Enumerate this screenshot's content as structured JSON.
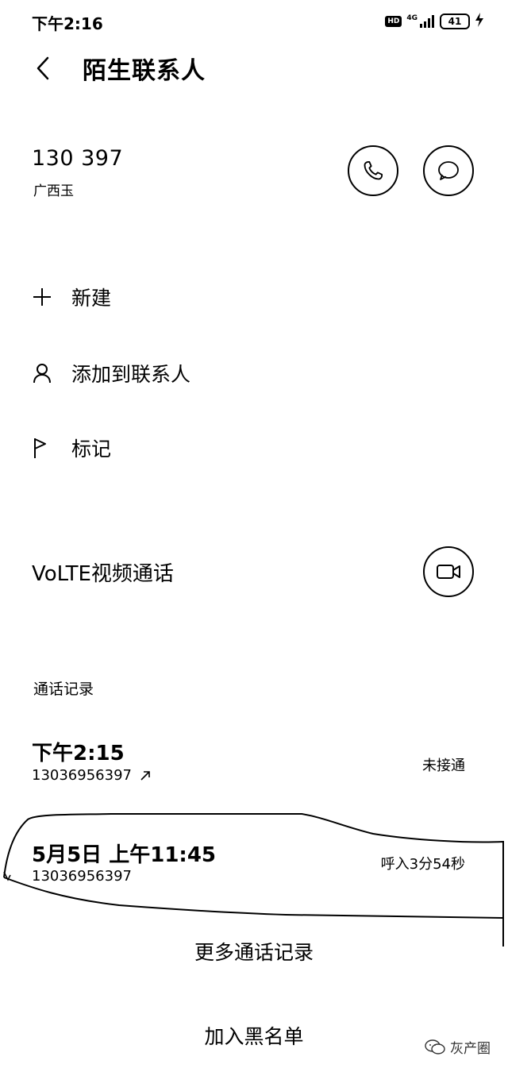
{
  "status_bar": {
    "time": "下午2:16",
    "hd_label": "HD",
    "network_label": "4G",
    "battery_level": "41"
  },
  "header": {
    "title": "陌生联系人"
  },
  "contact": {
    "phone_number": "130          397",
    "location": "广西玉"
  },
  "actions": [
    {
      "label": "新建",
      "icon": "plus-icon"
    },
    {
      "label": "添加到联系人",
      "icon": "person-icon"
    },
    {
      "label": "标记",
      "icon": "flag-icon"
    }
  ],
  "volte": {
    "label": "VoLTE视频通话",
    "icon": "video-camera-icon"
  },
  "call_log": {
    "section_title": "通话记录",
    "entries": [
      {
        "time": "下午2:15",
        "number": "13036956397",
        "direction": "outgoing",
        "status": "未接通"
      },
      {
        "time": "5月5日 上午11:45",
        "number": "13036956397",
        "direction": "incoming",
        "status": "呼入3分54秒"
      }
    ]
  },
  "more_calls_label": "更多通话记录",
  "blacklist_label": "加入黑名单",
  "watermark": {
    "text": "灰产圈",
    "icon": "wechat-icon"
  }
}
